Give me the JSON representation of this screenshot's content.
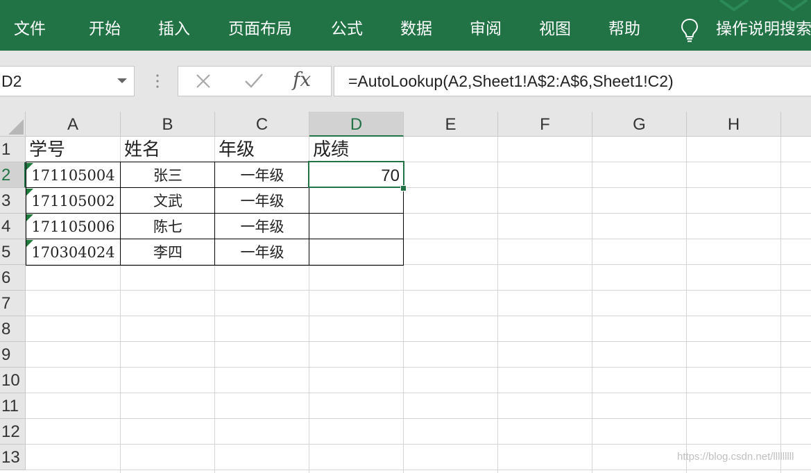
{
  "ribbon": {
    "tabs": [
      "文件",
      "开始",
      "插入",
      "页面布局",
      "公式",
      "数据",
      "审阅",
      "视图",
      "帮助"
    ],
    "tell_me": "操作说明搜索",
    "tell_me_icon": "lightbulb-icon",
    "accent_color": "#217346"
  },
  "formula_bar": {
    "name_box": "D2",
    "formula": "=AutoLookup(A2,Sheet1!A$2:A$6,Sheet1!C2)",
    "fx_label": "fx",
    "icons": [
      "cancel-icon",
      "enter-icon",
      "insert-function-icon"
    ]
  },
  "sheet": {
    "columns": [
      "A",
      "B",
      "C",
      "D",
      "E",
      "F",
      "G",
      "H"
    ],
    "rows": [
      "1",
      "2",
      "3",
      "4",
      "5",
      "6",
      "7",
      "8",
      "9",
      "10",
      "11",
      "12",
      "13"
    ],
    "selected_cell": "D2",
    "header_row": [
      "学号",
      "姓名",
      "年级",
      "成绩"
    ],
    "data": [
      {
        "id": "171105004",
        "name": "张三",
        "grade": "一年级",
        "score": "70"
      },
      {
        "id": "171105002",
        "name": "文武",
        "grade": "一年级",
        "score": ""
      },
      {
        "id": "171105006",
        "name": "陈七",
        "grade": "一年级",
        "score": ""
      },
      {
        "id": "170304024",
        "name": "李四",
        "grade": "一年级",
        "score": ""
      }
    ]
  },
  "watermark": "https://blog.csdn.net/lllllllll"
}
